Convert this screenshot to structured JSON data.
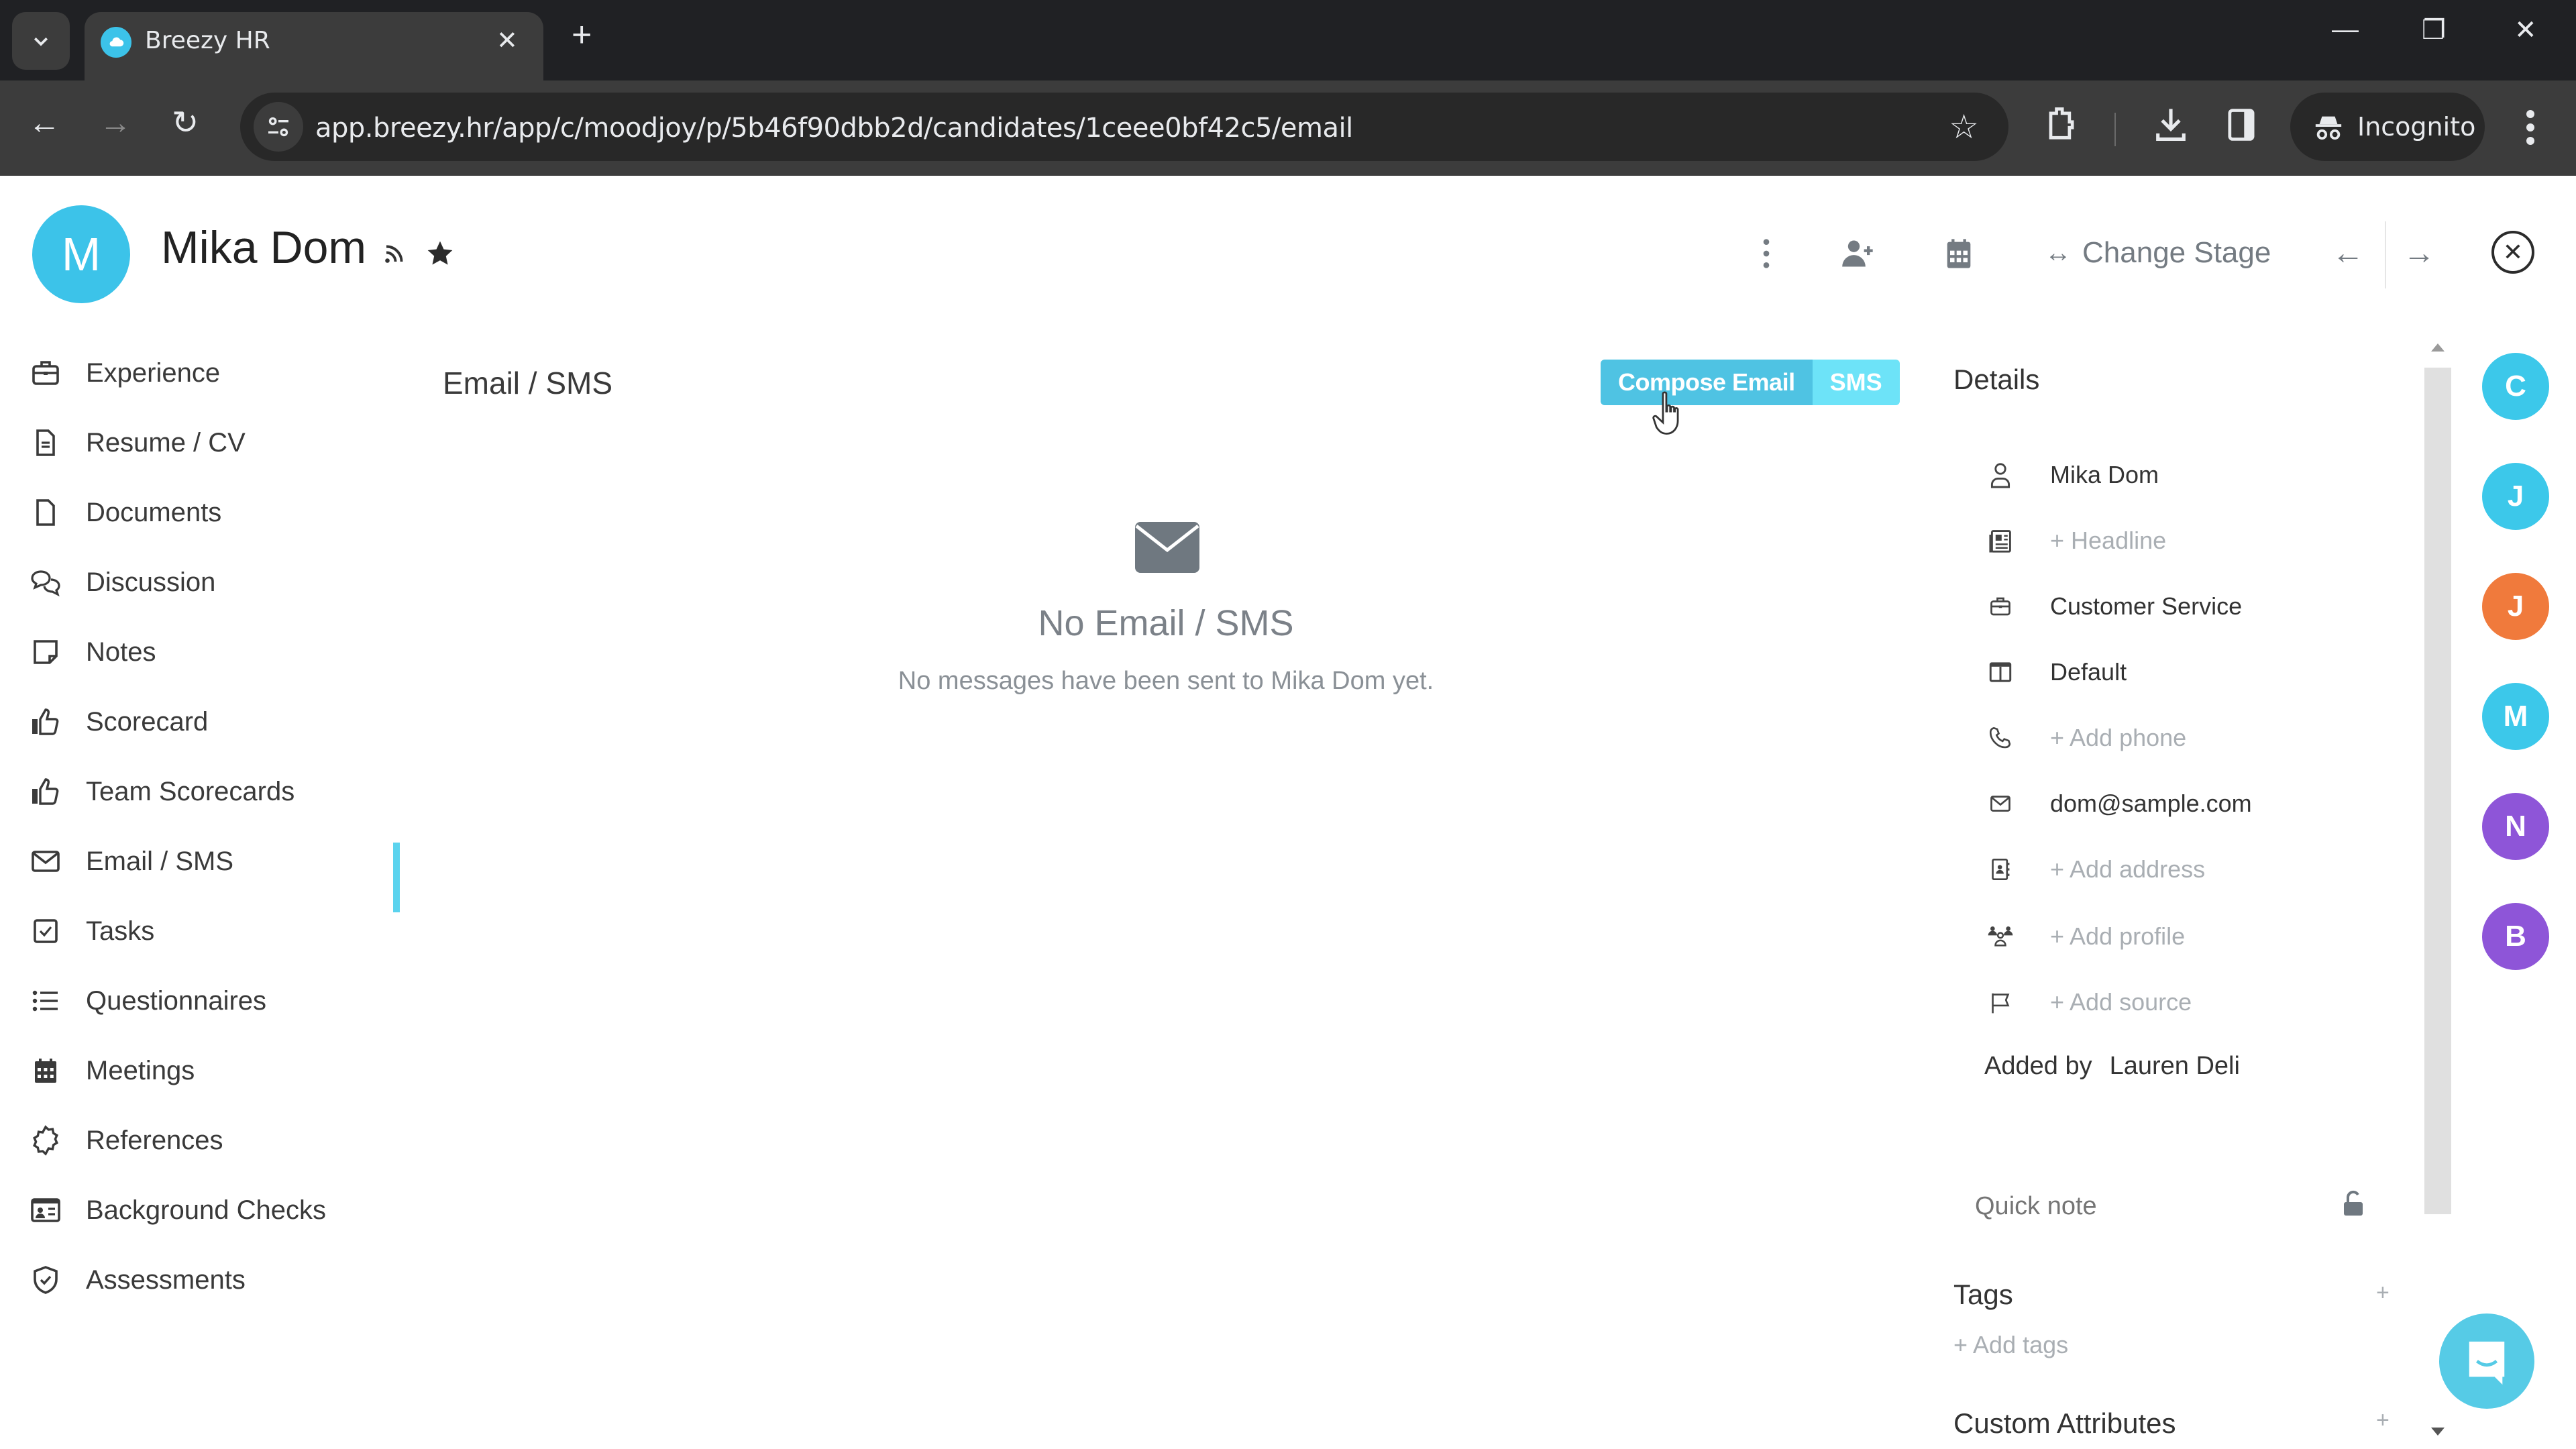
{
  "browser": {
    "tab_title": "Breezy HR",
    "url": "app.breezy.hr/app/c/moodjoy/p/5b46f90dbb2d/candidates/1ceee0bf42c5/email",
    "incognito_label": "Incognito"
  },
  "header": {
    "avatar_initial": "M",
    "candidate_name": "Mika Dom",
    "change_stage_label": "Change Stage"
  },
  "nav": {
    "items": [
      {
        "label": "Experience",
        "icon": "briefcase-icon"
      },
      {
        "label": "Resume / CV",
        "icon": "file-text-icon"
      },
      {
        "label": "Documents",
        "icon": "file-icon"
      },
      {
        "label": "Discussion",
        "icon": "chat-bubbles-icon"
      },
      {
        "label": "Notes",
        "icon": "sticky-note-icon"
      },
      {
        "label": "Scorecard",
        "icon": "thumbs-up-icon"
      },
      {
        "label": "Team Scorecards",
        "icon": "thumbs-up-icon"
      },
      {
        "label": "Email / SMS",
        "icon": "envelope-icon"
      },
      {
        "label": "Tasks",
        "icon": "checkbox-icon"
      },
      {
        "label": "Questionnaires",
        "icon": "list-icon"
      },
      {
        "label": "Meetings",
        "icon": "calendar-icon"
      },
      {
        "label": "References",
        "icon": "badge-icon"
      },
      {
        "label": "Background Checks",
        "icon": "id-card-icon"
      },
      {
        "label": "Assessments",
        "icon": "shield-check-icon"
      }
    ],
    "active": "Email / SMS"
  },
  "main": {
    "title": "Email / SMS",
    "compose_email_label": "Compose Email",
    "sms_label": "SMS",
    "empty_title": "No Email / SMS",
    "empty_subtitle": "No messages have been sent to Mika Dom yet."
  },
  "details": {
    "title": "Details",
    "rows": [
      {
        "icon": "person-icon",
        "text": "Mika Dom",
        "placeholder": false
      },
      {
        "icon": "newspaper-icon",
        "text": "+ Headline",
        "placeholder": true
      },
      {
        "icon": "briefcase-icon",
        "text": "Customer Service",
        "placeholder": false
      },
      {
        "icon": "layout-icon",
        "text": "Default",
        "placeholder": false
      },
      {
        "icon": "phone-icon",
        "text": "+ Add phone",
        "placeholder": true
      },
      {
        "icon": "envelope-icon",
        "text": "dom@sample.com",
        "placeholder": false
      },
      {
        "icon": "address-book-icon",
        "text": "+ Add address",
        "placeholder": true
      },
      {
        "icon": "users-icon",
        "text": "+ Add profile",
        "placeholder": true
      },
      {
        "icon": "flag-icon",
        "text": "+ Add source",
        "placeholder": true
      }
    ],
    "added_by_label": "Added by",
    "added_by_name": "Lauren Deli",
    "quick_note_placeholder": "Quick note",
    "tags_title": "Tags",
    "add_tags_label": "+ Add tags",
    "custom_attributes_title": "Custom Attributes"
  },
  "rail": {
    "avatars": [
      {
        "initial": "C",
        "color": "#3cc8ea"
      },
      {
        "initial": "J",
        "color": "#3cc8ea"
      },
      {
        "initial": "J",
        "color": "#f07a3c"
      },
      {
        "initial": "M",
        "color": "#3cc8ea"
      },
      {
        "initial": "N",
        "color": "#8e55d8"
      },
      {
        "initial": "B",
        "color": "#8e55d8"
      }
    ]
  },
  "colors": {
    "brand": "#3cc3e9",
    "compose_button": "#4fc3e3",
    "sms_button": "#6de3f8",
    "active_indicator": "#5bd3ee"
  }
}
